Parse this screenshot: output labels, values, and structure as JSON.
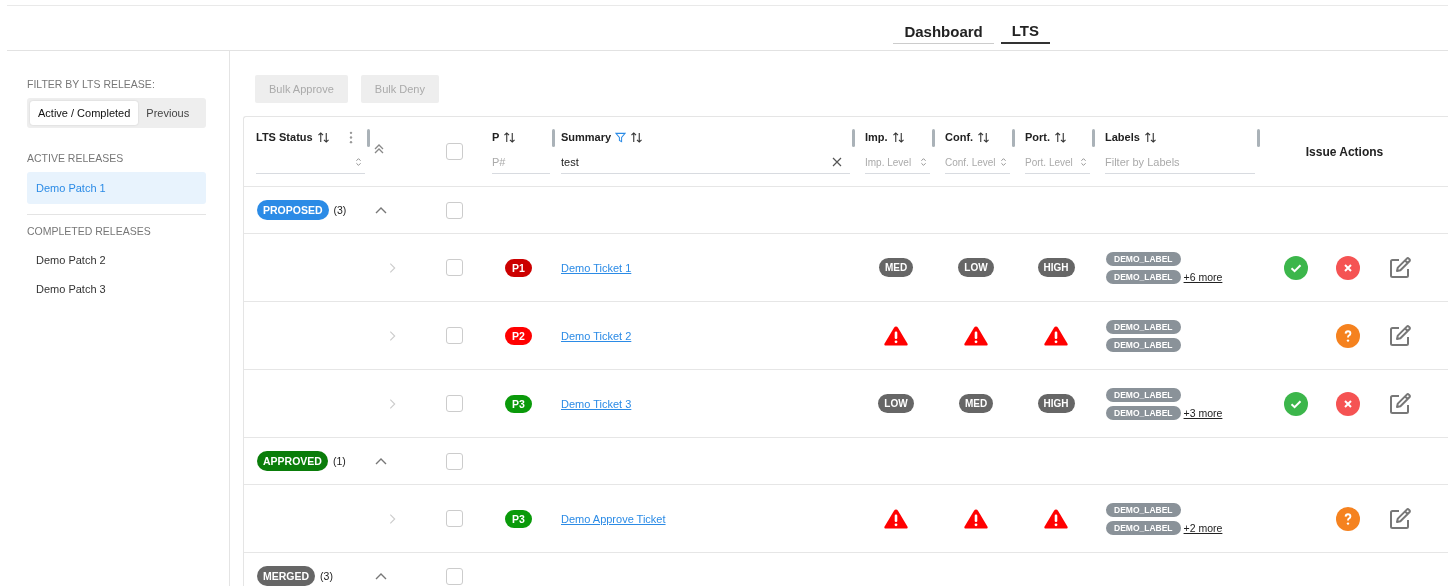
{
  "nav_tabs": [
    {
      "label": "Dashboard",
      "selected": false
    },
    {
      "label": "LTS",
      "selected": true
    }
  ],
  "sidebar": {
    "filter_heading": "FILTER BY LTS RELEASE:",
    "filter_toggle": [
      {
        "label": "Active / Completed",
        "selected": true
      },
      {
        "label": "Previous",
        "selected": false
      }
    ],
    "sections": [
      {
        "heading": "ACTIVE RELEASES",
        "items": [
          {
            "label": "Demo Patch 1",
            "selected": true
          }
        ]
      },
      {
        "heading": "COMPLETED RELEASES",
        "items": [
          {
            "label": "Demo Patch 2",
            "selected": false
          },
          {
            "label": "Demo Patch 3",
            "selected": false
          }
        ]
      }
    ]
  },
  "toolbar": {
    "buttons": [
      {
        "label": "Bulk Approve",
        "disabled": true
      },
      {
        "label": "Bulk Deny",
        "disabled": true
      }
    ]
  },
  "table": {
    "columns": [
      {
        "kind": "status",
        "label": "LTS Status",
        "sortable": true,
        "menu": true,
        "resizable": true,
        "filter": {
          "kind": "select"
        }
      },
      {
        "kind": "collapse"
      },
      {
        "kind": "select",
        "checked": false
      },
      {
        "kind": "priority",
        "label": "P",
        "sortable": true,
        "resizable": true,
        "filter": {
          "kind": "text",
          "placeholder": "P#"
        }
      },
      {
        "kind": "summary",
        "label": "Summary",
        "sortable": true,
        "filtered": true,
        "resizable": true,
        "filter": {
          "kind": "text",
          "value": "test",
          "clearable": true
        }
      },
      {
        "kind": "level",
        "label": "Imp.",
        "sortable": true,
        "resizable": true,
        "filter": {
          "kind": "select",
          "placeholder": "Imp. Level"
        }
      },
      {
        "kind": "level",
        "label": "Conf.",
        "sortable": true,
        "resizable": true,
        "filter": {
          "kind": "select",
          "placeholder": "Conf. Level"
        }
      },
      {
        "kind": "level",
        "label": "Port.",
        "sortable": true,
        "resizable": true,
        "filter": {
          "kind": "select",
          "placeholder": "Port. Level"
        }
      },
      {
        "kind": "labels",
        "label": "Labels",
        "sortable": true,
        "resizable": true,
        "filter": {
          "kind": "text",
          "placeholder": "Filter by Labels"
        }
      },
      {
        "kind": "actions",
        "label": "Issue Actions"
      }
    ],
    "groups": [
      {
        "status": "PROPOSED",
        "color": "#2b8be6",
        "count": "(3)",
        "expanded": true,
        "checked": false,
        "tickets": [
          {
            "priority": "P1",
            "color": "#cc0000",
            "summary": "Demo Ticket 1",
            "checked": false,
            "expanded": false,
            "levels": [
              {
                "kind": "badge",
                "text": "MED"
              },
              {
                "kind": "badge",
                "text": "LOW"
              },
              {
                "kind": "badge",
                "text": "HIGH"
              }
            ],
            "labels": [
              "DEMO_LABEL",
              "DEMO_LABEL"
            ],
            "more": "+6 more",
            "actions": [
              {
                "kind": "approve"
              },
              {
                "kind": "deny"
              },
              {
                "kind": "edit"
              }
            ]
          },
          {
            "priority": "P2",
            "color": "#ff0000",
            "summary": "Demo Ticket 2",
            "checked": false,
            "expanded": false,
            "levels": [
              {
                "kind": "warning"
              },
              {
                "kind": "warning"
              },
              {
                "kind": "warning"
              }
            ],
            "labels": [
              "DEMO_LABEL",
              "DEMO_LABEL"
            ],
            "actions": [
              {
                "kind": "review"
              },
              {
                "kind": "edit"
              }
            ]
          },
          {
            "priority": "P3",
            "color": "#0a9a0a",
            "summary": "Demo Ticket 3",
            "checked": false,
            "expanded": false,
            "levels": [
              {
                "kind": "badge",
                "text": "LOW"
              },
              {
                "kind": "badge",
                "text": "MED"
              },
              {
                "kind": "badge",
                "text": "HIGH"
              }
            ],
            "labels": [
              "DEMO_LABEL",
              "DEMO_LABEL"
            ],
            "more": "+3 more",
            "actions": [
              {
                "kind": "approve"
              },
              {
                "kind": "deny"
              },
              {
                "kind": "edit"
              }
            ]
          }
        ]
      },
      {
        "status": "APPROVED",
        "color": "#0a7d0a",
        "count": "(1)",
        "expanded": true,
        "checked": false,
        "tickets": [
          {
            "priority": "P3",
            "color": "#0a9a0a",
            "summary": "Demo Approve Ticket",
            "checked": false,
            "expanded": false,
            "levels": [
              {
                "kind": "warning"
              },
              {
                "kind": "warning"
              },
              {
                "kind": "warning"
              }
            ],
            "labels": [
              "DEMO_LABEL",
              "DEMO_LABEL"
            ],
            "more": "+2 more",
            "actions": [
              {
                "kind": "review"
              },
              {
                "kind": "edit"
              }
            ]
          }
        ]
      },
      {
        "status": "MERGED",
        "color": "#666666",
        "count": "(3)",
        "expanded": true,
        "checked": false
      }
    ]
  }
}
